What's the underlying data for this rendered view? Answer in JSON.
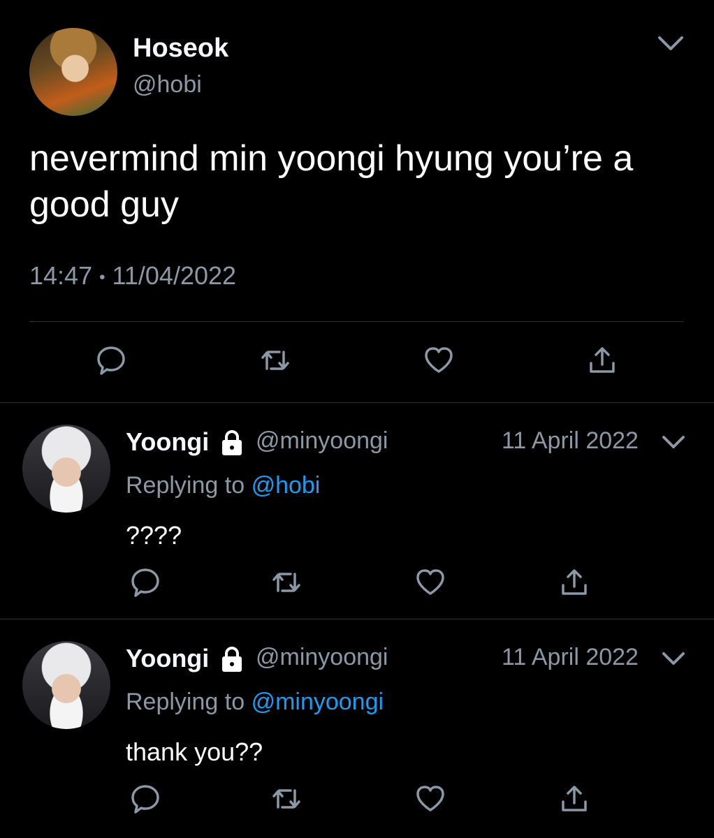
{
  "main_tweet": {
    "display_name": "Hoseok",
    "handle": "@hobi",
    "text": "nevermind min yoongi hyung you’re a good guy",
    "time": "14:47",
    "separator": "•",
    "date": "11/04/2022"
  },
  "replies": [
    {
      "display_name": "Yoongi",
      "handle": "@minyoongi",
      "date": "11 April 2022",
      "replying_prefix": "Replying to",
      "replying_to": "@hobi",
      "text": "????"
    },
    {
      "display_name": "Yoongi",
      "handle": "@minyoongi",
      "date": "11 April 2022",
      "replying_prefix": "Replying to",
      "replying_to": "@minyoongi",
      "text": "thank you??"
    }
  ],
  "icons": {
    "reply": "speech-bubble-icon",
    "retweet": "retweet-icon",
    "like": "heart-icon",
    "share": "share-icon",
    "more": "chevron-down-icon",
    "protected": "lock-icon"
  },
  "colors": {
    "background": "#000000",
    "text": "#ffffff",
    "secondary": "#8b98a5",
    "link": "#1d9bf0",
    "divider": "#2f3336"
  }
}
